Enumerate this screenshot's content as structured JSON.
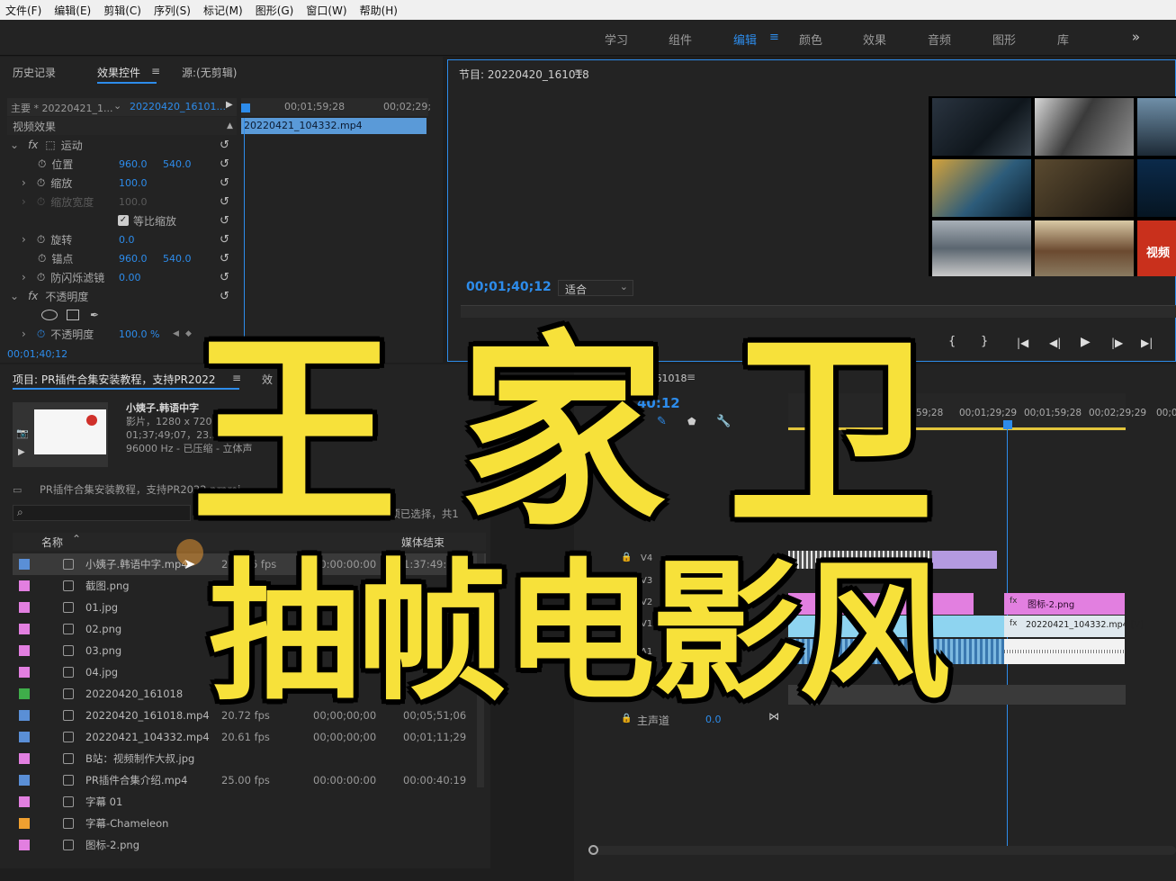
{
  "menu": [
    "文件(F)",
    "编辑(E)",
    "剪辑(C)",
    "序列(S)",
    "标记(M)",
    "图形(G)",
    "窗口(W)",
    "帮助(H)"
  ],
  "workspaces": [
    "学习",
    "组件",
    "编辑",
    "颜色",
    "效果",
    "音频",
    "图形",
    "库"
  ],
  "workspace_more": "»",
  "effects_panel": {
    "tabs": [
      "历史记录",
      "效果控件",
      "源:(无剪辑)"
    ],
    "master": "主要 * 20220421_1...",
    "sequence": "20220420_16101...",
    "ruler_t1": "00;01;59;28",
    "ruler_t2": "00;02;29;",
    "clip": "20220421_104332.mp4",
    "section": "视频效果",
    "motion": "运动",
    "position": {
      "label": "位置",
      "x": "960.0",
      "y": "540.0"
    },
    "scale": {
      "label": "缩放",
      "value": "100.0"
    },
    "scale_width": {
      "label": "缩放宽度",
      "value": "100.0"
    },
    "uniform": "等比缩放",
    "rotation": {
      "label": "旋转",
      "value": "0.0"
    },
    "anchor": {
      "label": "锚点",
      "x": "960.0",
      "y": "540.0"
    },
    "flicker": {
      "label": "防闪烁滤镜",
      "value": "0.00"
    },
    "opacity_section": "不透明度",
    "opacity": {
      "label": "不透明度",
      "value": "100.0 %"
    },
    "timecode": "00;01;40;12"
  },
  "program_monitor": {
    "title": "节目: 20220420_161018",
    "timecode": "00;01;40;12",
    "fit": "适合",
    "overlay_text": "视频"
  },
  "project": {
    "tab": "项目: PR插件合集安装教程，支持PR2022",
    "tab2": "效",
    "preview_name": "小姨子.韩语中字",
    "preview_l1": "影片，1280 x 720",
    "preview_l2": "01;37;49;07，23.97",
    "preview_l3": "96000 Hz - 已压缩 - 立体声",
    "proj_file": "PR插件合集安装教程，支持PR2022.prproj",
    "selected_info": "1项已选择，共1",
    "col_name": "名称",
    "col_end": "媒体结束",
    "items": [
      {
        "name": "小姨子.韩语中字.mp4",
        "fps": "23.976 fps",
        "start": "00:00:00:00",
        "end": "1:37:49:06",
        "color": "#5a8fd6"
      },
      {
        "name": "截图.png",
        "fps": "",
        "start": "",
        "end": "",
        "color": "#e27fe0"
      },
      {
        "name": "01.jpg",
        "fps": "",
        "start": "",
        "end": "",
        "color": "#e27fe0"
      },
      {
        "name": "02.png",
        "fps": "",
        "start": "",
        "end": "",
        "color": "#e27fe0"
      },
      {
        "name": "03.png",
        "fps": "",
        "start": "",
        "end": "",
        "color": "#e27fe0"
      },
      {
        "name": "04.jpg",
        "fps": "",
        "start": "",
        "end": "",
        "color": "#e27fe0"
      },
      {
        "name": "20220420_161018",
        "fps": "",
        "start": "",
        "end": "",
        "color": "#3fae4a"
      },
      {
        "name": "20220420_161018.mp4",
        "fps": "20.72 fps",
        "start": "00;00;00;00",
        "end": "00;05;51;06",
        "color": "#5a8fd6"
      },
      {
        "name": "20220421_104332.mp4",
        "fps": "20.61 fps",
        "start": "00;00;00;00",
        "end": "00;01;11;29",
        "color": "#5a8fd6"
      },
      {
        "name": "B站：视频制作大叔.jpg",
        "fps": "",
        "start": "",
        "end": "",
        "color": "#e27fe0"
      },
      {
        "name": "PR插件合集介绍.mp4",
        "fps": "25.00 fps",
        "start": "00:00:00:00",
        "end": "00:00:40:19",
        "color": "#5a8fd6"
      },
      {
        "name": "字幕 01",
        "fps": "",
        "start": "",
        "end": "",
        "color": "#e27fe0"
      },
      {
        "name": "字幕-Chameleon",
        "fps": "",
        "start": "",
        "end": "",
        "color": "#f0a030"
      },
      {
        "name": "图标-2.png",
        "fps": "",
        "start": "",
        "end": "",
        "color": "#e27fe0"
      }
    ]
  },
  "timeline": {
    "title": "_161018",
    "timecode": "40:12",
    "ruler": [
      "59;28",
      "00;01;29;29",
      "00;01;59;28",
      "00;02;29;29",
      "00;0"
    ],
    "tracks": [
      "V4",
      "V3",
      "V2",
      "V1",
      "A1"
    ],
    "clip_icon": "图标-2.png",
    "clip_video": "20220421_104332.mp4 [V]",
    "master": "主声道",
    "master_val": "0.0"
  },
  "overlay": {
    "title": "王 家 卫",
    "subtitle": "抽帧电影风"
  }
}
